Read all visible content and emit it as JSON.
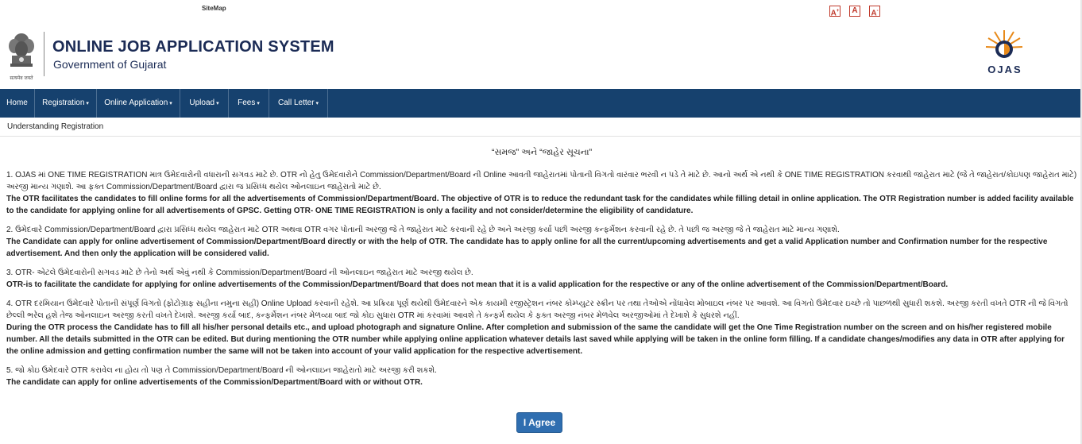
{
  "topbar": {
    "sitemap_label": "SiteMap",
    "font_increase": "A",
    "font_normal": "A",
    "font_decrease": "A"
  },
  "header": {
    "title": "ONLINE JOB APPLICATION SYSTEM",
    "subtitle": "Government of Gujarat",
    "emblem_caption": "सत्यमेव जयते",
    "logo_text": "OJAS"
  },
  "nav": {
    "items": [
      {
        "label": "Home",
        "caret": ""
      },
      {
        "label": "Registration",
        "caret": "▾"
      },
      {
        "label": "Online Application",
        "caret": "▾"
      },
      {
        "label": "Upload",
        "caret": "▾"
      },
      {
        "label": "Fees",
        "caret": "▾"
      },
      {
        "label": "Call Letter",
        "caret": "▾"
      }
    ]
  },
  "breadcrumb": "Understanding Registration",
  "notice": {
    "title": "“સમજ” અને “જાહેર સૂચના”",
    "points": [
      {
        "gujarati": "1. OJAS માં ONE TIME REGISTRATION માત્ર ઉમેદવારોની વધારાની સગવડ માટે છે. OTR નો હેતુ ઉમેદવારોને Commission/Department/Board ની Online આવતી જાહેરાતમાં પોતાની વિગતો વારંવાર ભરવી ન પડે તે માટે છે. આનો અર્થ એ નથી કે ONE TIME REGISTRATION કરવાથી જાહેરાત માટે (જે તે જાહેરાત/કોઇપણ જાહેરાત માટે) અરજી માન્ય ગણાશે. આ ફક્ત Commission/Department/Board દ્વારા જ પ્રસિધ્ધ થયેલ ઓનલાઇન જાહેરાતો માટે છે.",
        "english": "The OTR facilitates the candidates to fill online forms for all the advertisements of Commission/Department/Board. The objective of OTR is to reduce the redundant task for the candidates while filling detail in online application. The OTR Registration number is added facility available to the candidate for applying online for all advertisements of GPSC. Getting OTR- ONE TIME REGISTRATION is only a facility and not consider/determine the eligibility of candidature."
      },
      {
        "gujarati": "2. ઉમેદવારે Commission/Department/Board દ્વારા પ્રસિધ્ધ થયેલ જાહેરાત માટે OTR અથવા OTR વગર પોતાની અરજી જે તે જાહેરાત માટે કરવાની રહે છે અને અરજી કર્યા પછી અરજી કન્ફર્મેશન કરવાની રહે છે. તે પછી જ અરજી જે તે જાહેરાત માટે માન્ય ગણાશે.",
        "english": "The Candidate can apply for online advertisement of Commission/Department/Board directly or with the help of OTR. The candidate has to apply online for all the current/upcoming advertisements and get a valid Application number and Confirmation number for the respective advertisement. And then only the application will be considered valid."
      },
      {
        "gujarati": "3. OTR- એટલે ઉમેદવારોની સગવડ માટે છે તેનો અર્થ એવું નથી કે Commission/Department/Board ની ઓનલાઇન જાહેરાત માટે અરજી થયેલ છે.",
        "english": "OTR-is to facilitate the candidate for applying for online advertisements of the Commission/Department/Board that does not mean that it is a valid application for the respective or any of the online advertisement of the Commission/Department/Board."
      },
      {
        "gujarati": "4. OTR દરમિયાન ઉમેદવારે પોતાની સંપૂર્ણ વિગતો (ફોટોગ્રાફ સહીના નમુના સહી) Online Upload કરવાની રહેશે. આ પ્રક્રિયા પૂર્ણ થયેથી ઉમેદવારને એક કાયમી રજીસ્ટ્રેશન નંબર કોમ્પ્યુટર સ્ક્રીન પર તથા તેઓએ નોંધાવેલ મોબાઇલ નંબર પર આવશે. આ વિગતો ઉમેદવાર ઇચ્છે તો પાછળથી સુધારી શકશે. અરજી કરતી વખતે OTR ની જે વિગતો છેલ્લી ભરેલ હશે તેજ ઓનલાઇન અરજી કરતી વખતે દેખાશે. અરજી કર્યા બાદ, કન્ફર્મેશન નંબર મેળવ્યા બાદ જો કોઇ સુધારા OTR માં કરવામાં આવશે તે કન્ફર્મ થયેલ કે ફક્ત અરજી નંબર મેળવેલ અરજીઓમાં તે દેખાશે કે સુધરશે નહીં.",
        "english": "During the OTR process the Candidate has to fill all his/her personal details etc., and upload photograph and signature Online. After completion and submission of the same the candidate will get the One Time Registration number on the screen and on his/her registered mobile number. All the details submitted in the OTR can be edited. But during mentioning the OTR number while applying online application whatever details last saved while applying will be taken in the online form filling. If a candidate changes/modifies any data in OTR after applying for the online admission and getting confirmation number the same will not be taken into account of your valid application for the respective advertisement."
      },
      {
        "gujarati": "5. જો કોઇ ઉમેદવારે OTR કરાવેલ ના હોય તો પણ તે Commission/Department/Board ની ઓનલાઇન જાહેરાતો માટે અરજી કરી શકશે.",
        "english": "The candidate can apply for online advertisements of the Commission/Department/Board with or without OTR."
      }
    ]
  },
  "agree_button": "I Agree",
  "colors": {
    "navbar": "#16416e",
    "title": "#1b2b55",
    "button": "#2f6eb0",
    "font_btn": "#c0392b"
  }
}
